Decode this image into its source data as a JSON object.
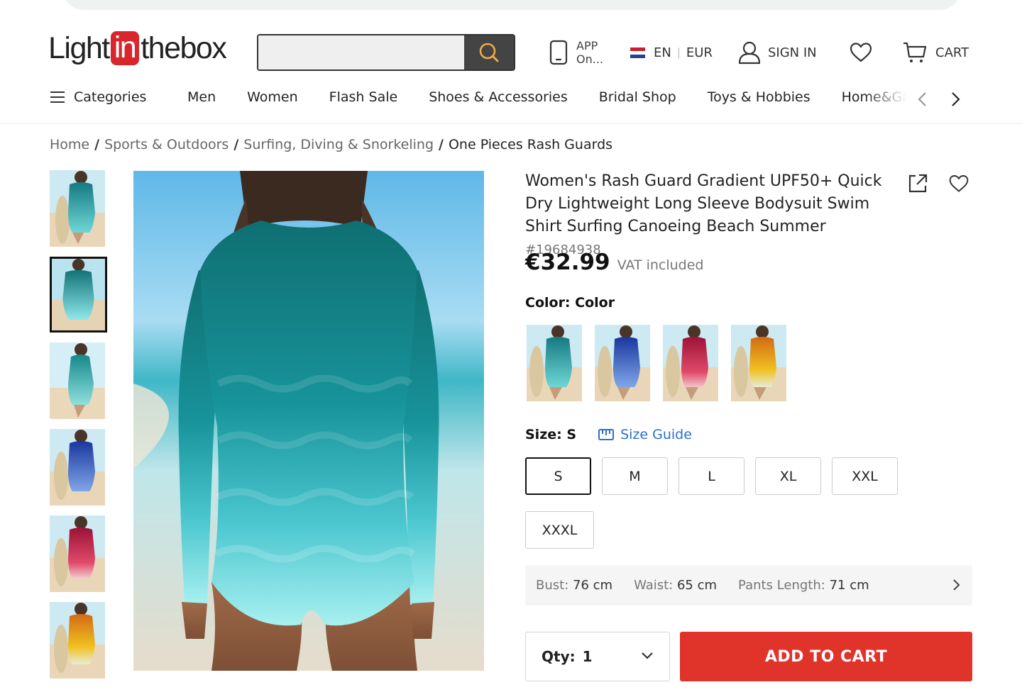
{
  "header": {
    "logo_left": "Light",
    "logo_in": "in",
    "logo_right": "thebox",
    "search_placeholder": "",
    "app_line1": "APP",
    "app_line2": "On...",
    "lang": "EN",
    "currency": "EUR",
    "sign_in": "SIGN IN",
    "cart": "CART"
  },
  "nav": {
    "categories": "Categories",
    "items": [
      "Men",
      "Women",
      "Flash Sale",
      "Shoes & Accessories",
      "Bridal Shop",
      "Toys & Hobbies",
      "Home&Garden"
    ]
  },
  "breadcrumb": [
    "Home",
    "Sports & Outdoors",
    "Surfing, Diving & Snorkeling",
    "One Pieces Rash Guards"
  ],
  "product": {
    "title": "Women's Rash Guard Gradient UPF50+ Quick Dry Lightweight Long Sleeve Bodysuit Swim Shirt Surfing Canoeing Beach Summer",
    "sku": "#19684938",
    "price": "€32.99",
    "vat": "VAT included",
    "color_label": "Color:",
    "color_value": "Color",
    "size_label": "Size:",
    "size_value": "S",
    "size_guide": "Size Guide",
    "sizes": [
      "S",
      "M",
      "L",
      "XL",
      "XXL",
      "XXXL"
    ],
    "selected_size": "S",
    "measurements": [
      {
        "label": "Bust:",
        "value": "76 cm"
      },
      {
        "label": "Waist:",
        "value": "65 cm"
      },
      {
        "label": "Pants Length:",
        "value": "71 cm"
      }
    ],
    "qty_label": "Qty:",
    "qty_value": "1",
    "add_to_cart": "ADD TO CART"
  },
  "colors": {
    "accent_red": "#e0332a",
    "link_blue": "#2a6fc9",
    "variant_teal": "#1f9a9a",
    "variant_blue": "#1d3fa8",
    "variant_red": "#b3143a",
    "variant_orange": "#d9751c"
  },
  "gallery": {
    "thumbnails": [
      "teal-front",
      "teal-back",
      "teal-side",
      "blue-front",
      "red-front",
      "orange-front"
    ],
    "active_index": 1
  }
}
